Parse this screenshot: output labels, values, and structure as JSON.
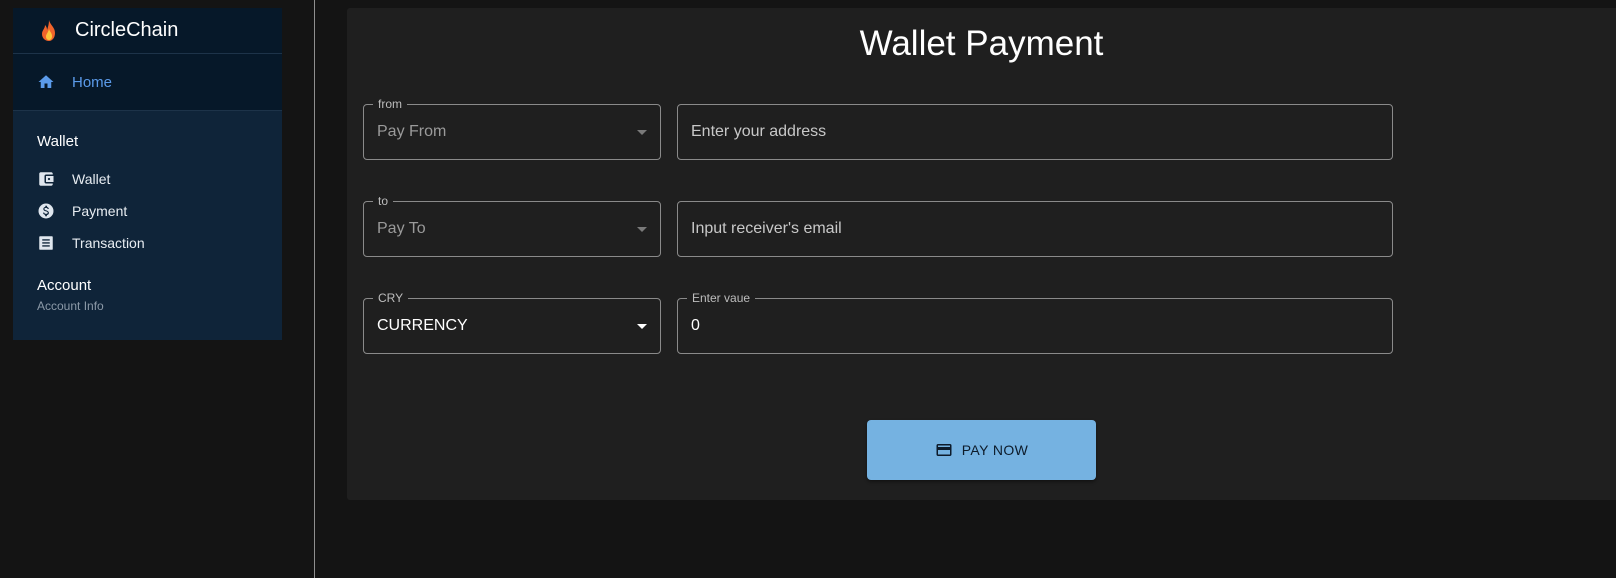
{
  "sidebar": {
    "brand": "CircleChain",
    "home_label": "Home",
    "wallet_section": "Wallet",
    "items": [
      {
        "label": "Wallet",
        "icon": "wallet-icon"
      },
      {
        "label": "Payment",
        "icon": "dollar-circle-icon"
      },
      {
        "label": "Transaction",
        "icon": "receipt-icon"
      }
    ],
    "account_title": "Account",
    "account_subtitle": "Account Info"
  },
  "main": {
    "title": "Wallet Payment",
    "from": {
      "legend": "from",
      "select_value": "Pay From",
      "address_placeholder": "Enter your address"
    },
    "to": {
      "legend": "to",
      "select_value": "Pay To",
      "email_placeholder": "Input receiver's email"
    },
    "currency": {
      "legend": "CRY",
      "select_value": "CURRENCY"
    },
    "amount": {
      "legend": "Enter vaue",
      "value": "0"
    },
    "pay_button": "PAY NOW"
  },
  "colors": {
    "accent": "#5b9bea",
    "button": "#75b2e1",
    "sidebar": "#0f2439",
    "panel": "#1f1f1f"
  }
}
